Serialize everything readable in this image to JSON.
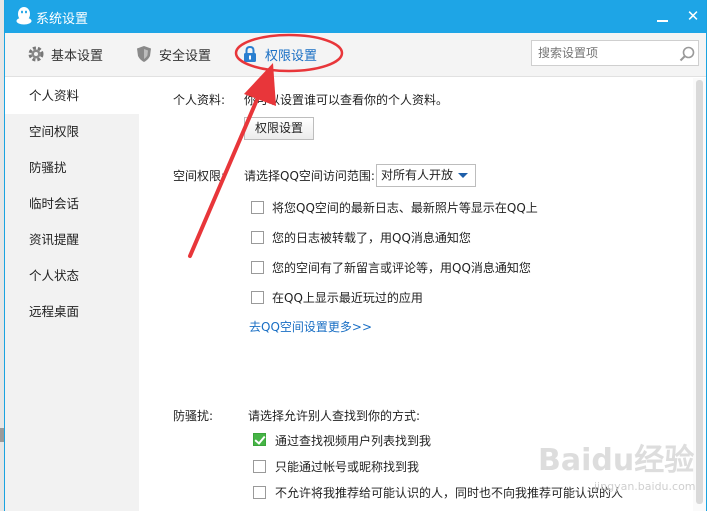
{
  "window": {
    "title": "系统设置",
    "minimize_label": "—",
    "close_label": "✕"
  },
  "toolbar": {
    "tabs": [
      {
        "label": "基本设置",
        "icon": "gear-icon"
      },
      {
        "label": "安全设置",
        "icon": "shield-icon"
      },
      {
        "label": "权限设置",
        "icon": "lock-icon"
      }
    ],
    "search_placeholder": "搜索设置项"
  },
  "sidebar": {
    "items": [
      {
        "label": "个人资料"
      },
      {
        "label": "空间权限"
      },
      {
        "label": "防骚扰"
      },
      {
        "label": "临时会话"
      },
      {
        "label": "资讯提醒"
      },
      {
        "label": "个人状态"
      },
      {
        "label": "远程桌面"
      }
    ]
  },
  "profile": {
    "label": "个人资料:",
    "desc": "你可以设置谁可以查看你的个人资料。",
    "button": "权限设置"
  },
  "space": {
    "label": "空间权限:",
    "prompt": "请选择QQ空间访问范围:",
    "select_value": "对所有人开放",
    "options": [
      {
        "text": "将您QQ空间的最新日志、最新照片等显示在QQ上",
        "checked": false
      },
      {
        "text": "您的日志被转载了，用QQ消息通知您",
        "checked": false
      },
      {
        "text": "您的空间有了新留言或评论等，用QQ消息通知您",
        "checked": false
      },
      {
        "text": "在QQ上显示最近玩过的应用",
        "checked": false
      }
    ],
    "more_link": "去QQ空间设置更多>>"
  },
  "antiharass": {
    "label": "防骚扰:",
    "prompt": "请选择允许别人查找到你的方式:",
    "options": [
      {
        "text": "通过查找视频用户列表找到我",
        "checked": true
      },
      {
        "text": "只能通过帐号或昵称找到我",
        "checked": false
      },
      {
        "text": "不允许将我推荐给可能认识的人，同时也不向我推荐可能认识的人",
        "checked": false
      }
    ]
  },
  "watermark": {
    "text": "Baidu经验",
    "url": "jingyan.baidu.com"
  },
  "colors": {
    "titlebar": "#1ea5e6",
    "annotation": "#e8363a",
    "link": "#1a6fc4",
    "checked": "#46b446"
  }
}
